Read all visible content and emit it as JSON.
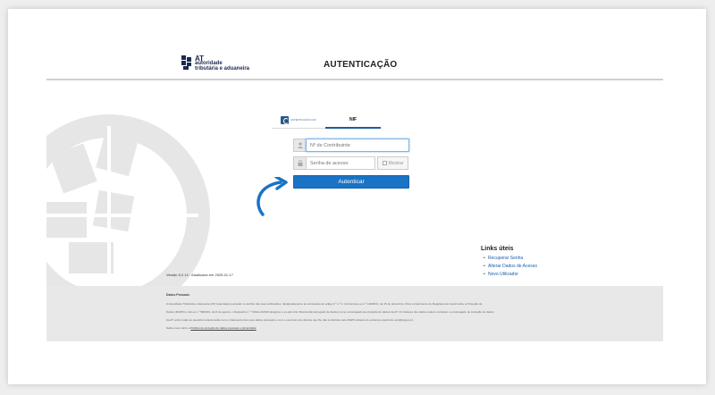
{
  "header": {
    "logo": {
      "line1": "AT",
      "line2": "autoridade",
      "line3": "tributária e aduaneira"
    },
    "title": "AUTENTICAÇÃO"
  },
  "tabs": [
    {
      "label": "AUTENTICAÇÃO.GOV"
    },
    {
      "label": "NIF"
    }
  ],
  "form": {
    "nif_placeholder": "Nº de Contribuinte",
    "password_placeholder": "Senha de acesso",
    "show_label": "Mostrar",
    "submit_label": "Autenticar"
  },
  "version": "Versão 5.2.14 · Atualizado em 2025-01-17",
  "links": {
    "title": "Links úteis",
    "items": [
      "Recuperar Senha",
      "Alterar Dados de Acesso",
      "Novo Utilizador"
    ]
  },
  "footer": {
    "title": "Dados Pessoais",
    "lines": [
      "A Autoridade Tributária e Aduaneira (AT) trata dados pessoais no âmbito das suas atribuições, designadamente as constantes do artigo 2.º n.º 2, do Decreto-Lei n.º 118/2011, de 15 de dezembro. Para cumprimento do Regulamento Geral sobre a Proteção de",
      "Dados (RGPD) e da Lei n.º 58/2019, de 8 de agosto, o Despacho n.º 7184A-A/2019 designou o ex-abc Arlo Oliveira (Encarregado de dados) como encarregado de proteção de dados da AT. Os titulares dos dados podem contactar o encarregado de proteção de dados",
      "da AT sobre todas as questões relacionadas com o tratamento dos seus dados pessoais e com o exercício dos direitos que lhe são conferidos pelo RGPD através do endereço eletrónico epd@at.gov.pt.",
      "Saiba mais sobre a "
    ],
    "policy_link": "Política de proteção de dados pessoais e privacidade"
  },
  "colors": {
    "primary_button": "#1a73c4",
    "link": "#1a5ea8",
    "logo": "#1d2a52",
    "footer_bg": "#e8e8e8"
  }
}
